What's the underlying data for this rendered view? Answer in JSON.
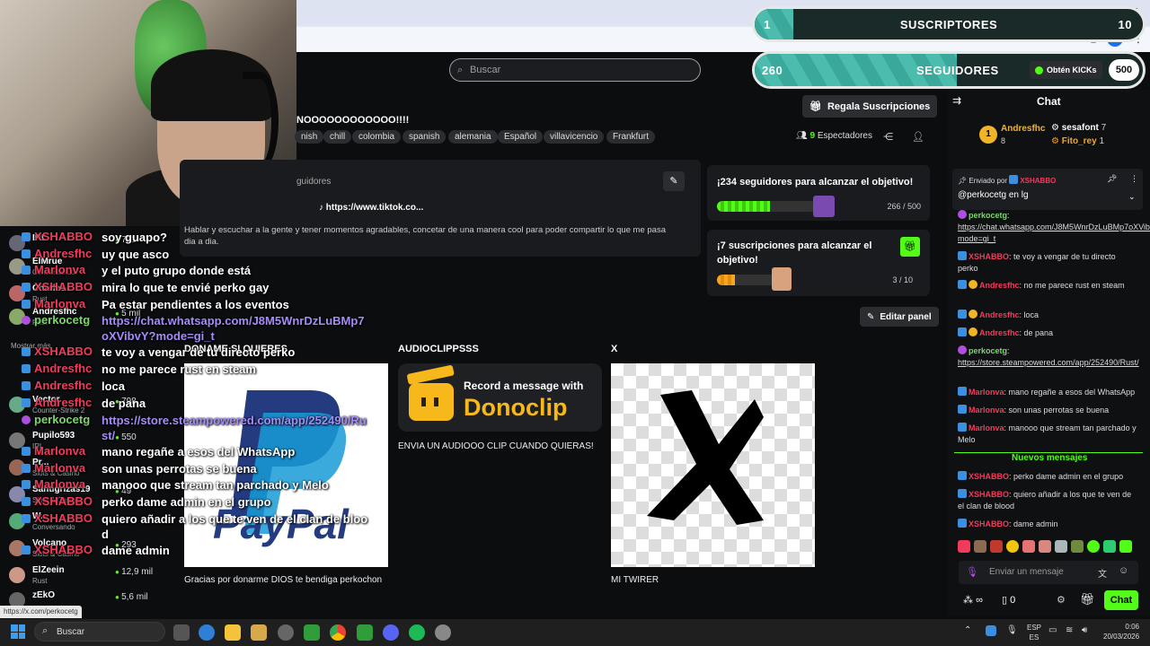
{
  "browser": {
    "icons": [
      "star-icon",
      "extension-icon",
      "download-icon",
      "profile-icon"
    ],
    "window_controls": [
      "—",
      "☐",
      "✕"
    ]
  },
  "goals_overlay": {
    "subs": {
      "current": "1",
      "label": "SUSCRIPTORES",
      "target": "10",
      "fill": 0.1
    },
    "followers": {
      "current": "260",
      "label": "SEGUIDORES",
      "fill": 0.52
    },
    "kicks_button": "Obtén KICKs",
    "kicks_balance": "500"
  },
  "header": {
    "search_placeholder": "Buscar"
  },
  "stream": {
    "title": "NOOOOOOOOOOOO!!!!",
    "tags": [
      "nish",
      "chill",
      "colombia",
      "spanish",
      "alemania",
      "Español",
      "villavicencio",
      "Frankfurt"
    ],
    "gift_button": "Regala Suscripciones",
    "viewers_count": "9",
    "viewers_label": "Espectadores"
  },
  "about": {
    "followers_label": "guidores",
    "tiktok": "https://www.tiktok.co...",
    "bio": "Hablar y escuchar a la gente y tener momentos agradables, concetar de una manera cool para poder compartir lo que me pasa dia a dia."
  },
  "goals": [
    {
      "text": "¡234 seguidores para alcanzar el objetivo!",
      "progress": "266 / 500",
      "fill": 0.532,
      "color": "#53fc18"
    },
    {
      "text": "¡7 suscripciones para alcanzar el objetivo!",
      "progress": "3 / 10",
      "fill": 0.3,
      "color": "#f6a623"
    }
  ],
  "edit_panel": "Editar panel",
  "panels": [
    {
      "title": "DONAME SI QUIERES",
      "caption": "Gracias por donarme DIOS te bendiga perkochon",
      "image": "paypal-logo"
    },
    {
      "title": "AUDIOCLIPPSSS",
      "caption": "ENVIA UN AUDIOOO CLIP CUANDO QUIERAS!",
      "image_line1": "Record a message with",
      "image_line2": "Donoclip"
    },
    {
      "title": "X",
      "caption": "MI TWIRER",
      "image": "x-logo"
    }
  ],
  "overlay_chat": [
    {
      "user": "XSHABBO",
      "msg": "soy guapo?"
    },
    {
      "user": "Andresfhc",
      "msg": "uy que asco"
    },
    {
      "user": "Marlonva",
      "msg": "y el puto grupo donde está"
    },
    {
      "user": "XSHABBO",
      "msg": "mira lo que te envié perko gay"
    },
    {
      "user": "Marlonva",
      "msg": "Pa estar pendientes a los eventos"
    },
    {
      "user": "perkocetg",
      "msg": "https://chat.whatsapp.com/J8M5WnrDzLuBMp7oXVibvY?mode=gi_t",
      "link": true
    },
    {
      "user": "XSHABBO",
      "msg": "te voy a vengar de tu directo perko"
    },
    {
      "user": "Andresfhc",
      "msg": "no me parece rust en steam"
    },
    {
      "user": "Andresfhc",
      "msg": "loca"
    },
    {
      "user": "Andresfhc",
      "msg": "de pana"
    },
    {
      "user": "perkocetg",
      "msg": "https://store.steampowered.com/app/252490/Rust/",
      "link": true
    },
    {
      "user": "Marlonva",
      "msg": "mano regañe a esos del WhatsApp"
    },
    {
      "user": "Marlonva",
      "msg": "son unas perrotas se buena"
    },
    {
      "user": "Marlonva",
      "msg": "manooo que stream tan parchado y Melo"
    },
    {
      "user": "XSHABBO",
      "msg": "perko dame admin en el grupo"
    },
    {
      "user": "XSHABBO",
      "msg": "quiero añadir a los que te ven de el clan de blood"
    },
    {
      "user": "XSHABBO",
      "msg": "dame admin"
    }
  ],
  "viewer_list": {
    "show_more": "Mostrar más",
    "items": [
      {
        "name": "IRL",
        "game": "",
        "viewers": "771"
      },
      {
        "name": "ElMrue",
        "game": "Conversando",
        "viewers": ""
      },
      {
        "name": "Charles",
        "game": "Rust",
        "viewers": ""
      },
      {
        "name": "Andresfhc",
        "game": "Rust",
        "viewers": "5 mil"
      },
      {
        "name": "Vector",
        "game": "Counter-Strike 2",
        "viewers": "798"
      },
      {
        "name": "Pupilo593",
        "game": "IRL",
        "viewers": "550"
      },
      {
        "name": "Pr...",
        "game": "Slots & Casino",
        "viewers": ""
      },
      {
        "name": "Santigrizas19",
        "game": "Slots & Casino",
        "viewers": "49"
      },
      {
        "name": "W...",
        "game": "Conversando",
        "viewers": ""
      },
      {
        "name": "Volcano",
        "game": "Slots & Casino",
        "viewers": "293"
      },
      {
        "name": "ElZeein",
        "game": "Rust",
        "viewers": "12,9 mil"
      },
      {
        "name": "zEkO",
        "game": "",
        "viewers": "5,6 mil"
      }
    ]
  },
  "status_url": "https://x.com/perkocetg",
  "chat": {
    "title": "Chat",
    "top_supporters": [
      {
        "name": "Andresfhc",
        "count": "8",
        "rank": "1"
      },
      {
        "name": "sesafont",
        "count": "7"
      },
      {
        "name": "Fito_rey",
        "count": "1"
      }
    ],
    "pinned_by_label": "Enviado por",
    "pinned_by": "XSHABBO",
    "pinned_msg": "@perkocetg en lg",
    "messages": [
      {
        "user": "perkocetg",
        "msg": "https://chat.whatsapp.com/J8M5WnrDzLuBMp7oXVibvY?mode=gi_t",
        "color": "g"
      },
      {
        "user": "XSHABBO",
        "msg": "te voy a vengar de tu directo perko"
      },
      {
        "user": "Andresfhc",
        "msg": "no me parece rust en steam"
      },
      {
        "user": "Andresfhc",
        "msg": "loca"
      },
      {
        "user": "Andresfhc",
        "msg": "de pana"
      },
      {
        "user": "perkocetg",
        "msg": "https://store.steampowered.com/app/252490/Rust/",
        "color": "g"
      },
      {
        "user": "Marlonva",
        "msg": "mano regañe a esos del WhatsApp"
      },
      {
        "user": "Marlonva",
        "msg": "son unas perrotas se buena"
      },
      {
        "user": "Marlonva",
        "msg": "manooo que stream tan parchado y Melo"
      }
    ],
    "new_messages_label": "Nuevos mensajes",
    "new_messages": [
      {
        "user": "XSHABBO",
        "msg": "perko dame admin en el grupo"
      },
      {
        "user": "XSHABBO",
        "msg": "quiero añadir a los que te ven de el clan de blood"
      },
      {
        "user": "XSHABBO",
        "msg": "dame admin"
      }
    ],
    "input_placeholder": "Enviar un mensaje",
    "points": "∞",
    "kicks": "0",
    "send_button": "Chat"
  },
  "taskbar": {
    "search": "Buscar",
    "lang1": "ESP",
    "lang2": "ES",
    "time": "0:06",
    "date": "20/03/2026"
  }
}
